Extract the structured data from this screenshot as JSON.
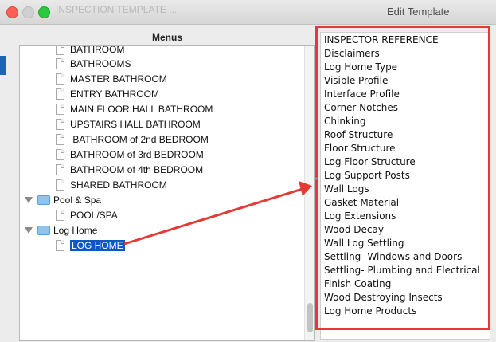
{
  "window": {
    "title": "Edit Template",
    "ghost_text": "INSPECTION TEMPLATE ..."
  },
  "menus": {
    "header": "Menus",
    "items": [
      {
        "label": "BATHROOM",
        "type": "file"
      },
      {
        "label": "BATHROOMS",
        "type": "file"
      },
      {
        "label": "MASTER BATHROOM",
        "type": "file"
      },
      {
        "label": "ENTRY BATHROOM",
        "type": "file"
      },
      {
        "label": "MAIN FLOOR HALL BATHROOM",
        "type": "file"
      },
      {
        "label": "UPSTAIRS HALL BATHROOM",
        "type": "file"
      },
      {
        "label": " BATHROOM of 2nd BEDROOM",
        "type": "file"
      },
      {
        "label": "BATHROOM of 3rd BEDROOM",
        "type": "file"
      },
      {
        "label": "BATHROOM of 4th BEDROOM",
        "type": "file"
      },
      {
        "label": "SHARED BATHROOM",
        "type": "file"
      },
      {
        "label": "Pool & Spa",
        "type": "folder"
      },
      {
        "label": "POOL/SPA",
        "type": "file"
      },
      {
        "label": "Log Home",
        "type": "folder"
      },
      {
        "label": "LOG HOME",
        "type": "file",
        "selected": true
      }
    ]
  },
  "sections": {
    "items": [
      "INSPECTOR REFERENCE",
      "Disclaimers",
      "Log Home Type",
      "Visible Profile",
      "Interface Profile",
      "Corner Notches",
      "Chinking",
      "Roof Structure",
      "Floor Structure",
      "Log Floor Structure",
      "Log Support Posts",
      "Wall Logs",
      "Gasket Material",
      "Log Extensions",
      "Wood Decay",
      "Wall Log Settling",
      "Settling- Windows and Doors",
      "Settling- Plumbing and Electrical",
      "Finish Coating",
      "Wood Destroying Insects",
      "Log Home Products"
    ]
  },
  "annotation": {
    "color": "#e53935"
  }
}
